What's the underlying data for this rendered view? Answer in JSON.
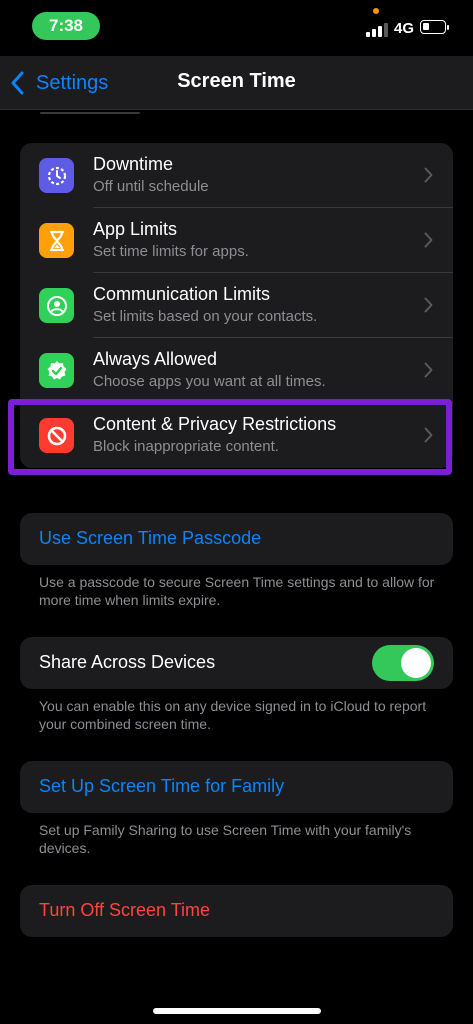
{
  "status_bar": {
    "time": "7:38",
    "network": "4G"
  },
  "nav": {
    "back_label": "Settings",
    "title": "Screen Time"
  },
  "colors": {
    "accent": "#0a84ff",
    "destructive": "#ff453a",
    "toggle_on": "#34c759",
    "highlight": "#7a1fd6"
  },
  "limits_group": {
    "items": [
      {
        "title": "Downtime",
        "subtitle": "Off until schedule",
        "icon": "downtime-icon",
        "icon_color": "#5e5ce6"
      },
      {
        "title": "App Limits",
        "subtitle": "Set time limits for apps.",
        "icon": "hourglass-icon",
        "icon_color": "#ff9f0a"
      },
      {
        "title": "Communication Limits",
        "subtitle": "Set limits based on your contacts.",
        "icon": "contact-icon",
        "icon_color": "#30d158"
      },
      {
        "title": "Always Allowed",
        "subtitle": "Choose apps you want at all times.",
        "icon": "checkmark-badge-icon",
        "icon_color": "#30d158"
      },
      {
        "title": "Content & Privacy Restrictions",
        "subtitle": "Block inappropriate content.",
        "icon": "restricted-icon",
        "icon_color": "#ff3b30"
      }
    ]
  },
  "passcode": {
    "label": "Use Screen Time Passcode",
    "footnote": "Use a passcode to secure Screen Time settings and to allow for more time when limits expire."
  },
  "share": {
    "label": "Share Across Devices",
    "enabled": true,
    "footnote": "You can enable this on any device signed in to iCloud to report your combined screen time."
  },
  "family": {
    "label": "Set Up Screen Time for Family",
    "footnote": "Set up Family Sharing to use Screen Time with your family's devices."
  },
  "turn_off": {
    "label": "Turn Off Screen Time"
  }
}
